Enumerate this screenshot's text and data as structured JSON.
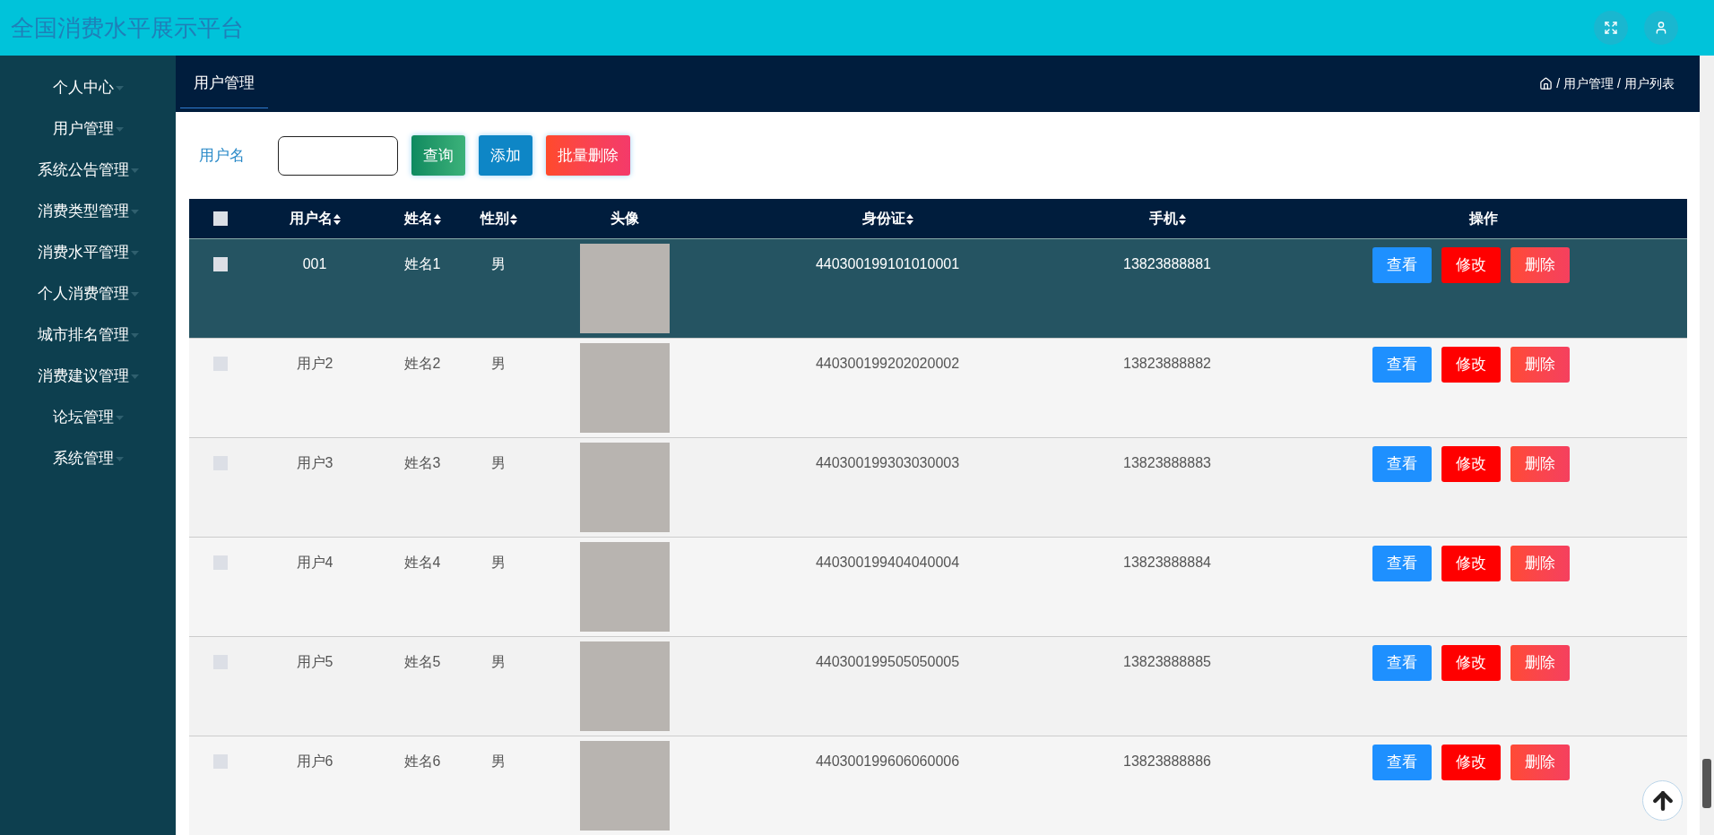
{
  "header": {
    "title": "全国消费水平展示平台"
  },
  "sidebar": {
    "items": [
      {
        "label": "个人中心"
      },
      {
        "label": "用户管理"
      },
      {
        "label": "系统公告管理"
      },
      {
        "label": "消费类型管理"
      },
      {
        "label": "消费水平管理"
      },
      {
        "label": "个人消费管理"
      },
      {
        "label": "城市排名管理"
      },
      {
        "label": "消费建议管理"
      },
      {
        "label": "论坛管理"
      },
      {
        "label": "系统管理"
      }
    ]
  },
  "tabs": [
    {
      "label": "用户管理",
      "selected": true
    }
  ],
  "breadcrumb": [
    {
      "separator": "/",
      "label": "用户管理"
    },
    {
      "separator": "/",
      "label": "用户列表"
    }
  ],
  "search": {
    "label": "用户名",
    "buttons": [
      {
        "label": "查询",
        "kind": "search"
      },
      {
        "label": "添加",
        "kind": "add"
      },
      {
        "label": "批量删除",
        "kind": "delete"
      }
    ]
  },
  "table": {
    "select_all_checked": false,
    "columns": [
      {
        "label": "用户名",
        "sortable": true
      },
      {
        "label": "姓名",
        "sortable": true
      },
      {
        "label": "性别",
        "sortable": true
      },
      {
        "label": "头像",
        "sortable": false
      },
      {
        "label": "身份证",
        "sortable": true
      },
      {
        "label": "手机",
        "sortable": true
      },
      {
        "label": "操作",
        "sortable": false
      }
    ],
    "rows": [
      {
        "checked": false,
        "username": "001",
        "name": "姓名1",
        "gender": "男",
        "id_card": "440300199101010001",
        "phone": "13823888881",
        "hovered": true,
        "actions": [
          {
            "label": "查看",
            "kind": "view"
          },
          {
            "label": "修改",
            "kind": "edit"
          },
          {
            "label": "删除",
            "kind": "delete"
          }
        ]
      },
      {
        "checked": false,
        "username": "用户2",
        "name": "姓名2",
        "gender": "男",
        "id_card": "440300199202020002",
        "phone": "13823888882",
        "hovered": false,
        "actions": [
          {
            "label": "查看",
            "kind": "view"
          },
          {
            "label": "修改",
            "kind": "edit"
          },
          {
            "label": "删除",
            "kind": "delete"
          }
        ]
      },
      {
        "checked": false,
        "username": "用户3",
        "name": "姓名3",
        "gender": "男",
        "id_card": "440300199303030003",
        "phone": "13823888883",
        "hovered": false,
        "actions": [
          {
            "label": "查看",
            "kind": "view"
          },
          {
            "label": "修改",
            "kind": "edit"
          },
          {
            "label": "删除",
            "kind": "delete"
          }
        ]
      },
      {
        "checked": false,
        "username": "用户4",
        "name": "姓名4",
        "gender": "男",
        "id_card": "440300199404040004",
        "phone": "13823888884",
        "hovered": false,
        "actions": [
          {
            "label": "查看",
            "kind": "view"
          },
          {
            "label": "修改",
            "kind": "edit"
          },
          {
            "label": "删除",
            "kind": "delete"
          }
        ]
      },
      {
        "checked": false,
        "username": "用户5",
        "name": "姓名5",
        "gender": "男",
        "id_card": "440300199505050005",
        "phone": "13823888885",
        "hovered": false,
        "actions": [
          {
            "label": "查看",
            "kind": "view"
          },
          {
            "label": "修改",
            "kind": "edit"
          },
          {
            "label": "删除",
            "kind": "delete"
          }
        ]
      },
      {
        "checked": false,
        "username": "用户6",
        "name": "姓名6",
        "gender": "男",
        "id_card": "440300199606060006",
        "phone": "13823888886",
        "hovered": false,
        "actions": [
          {
            "label": "查看",
            "kind": "view"
          },
          {
            "label": "修改",
            "kind": "edit"
          },
          {
            "label": "删除",
            "kind": "delete"
          }
        ]
      }
    ]
  }
}
